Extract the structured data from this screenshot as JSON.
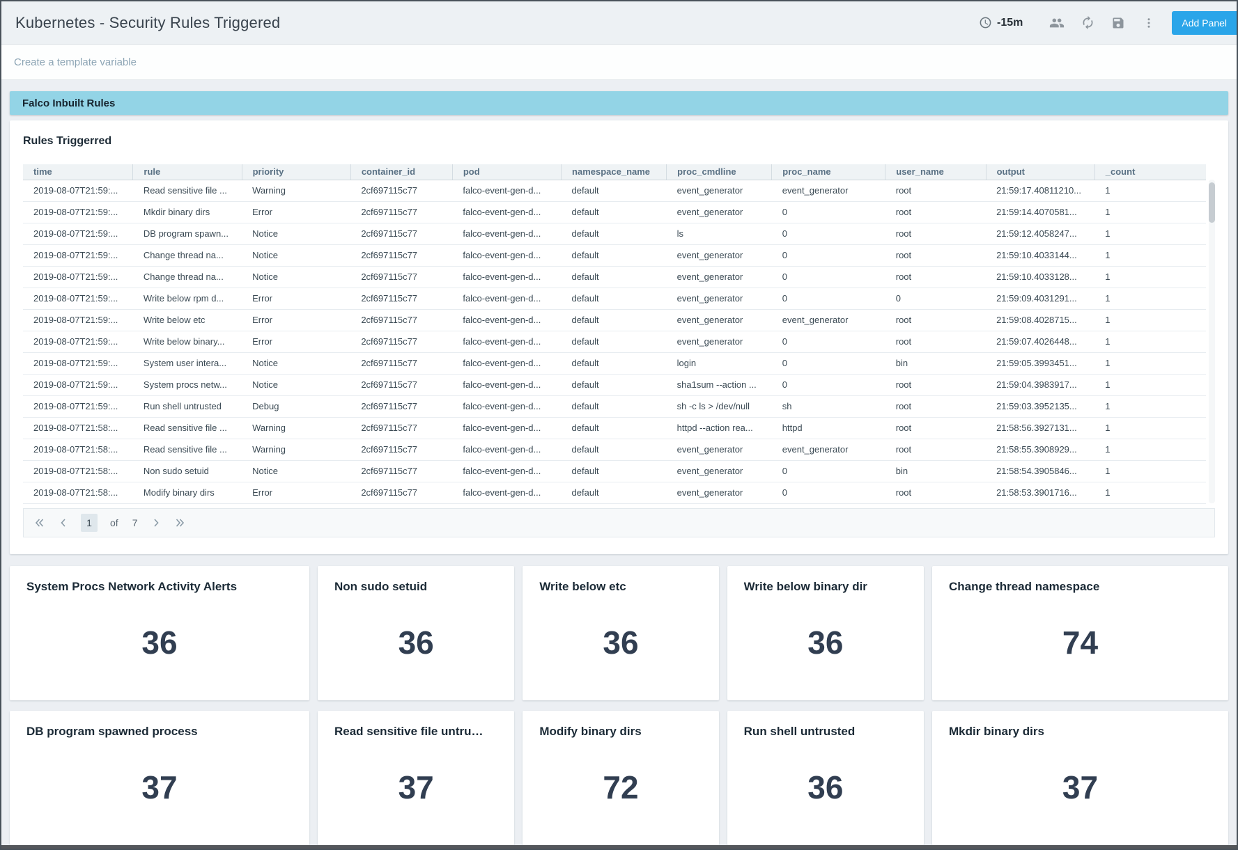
{
  "header": {
    "title": "Kubernetes - Security Rules Triggered",
    "time_range": "-15m",
    "add_panel_label": "Add Panel",
    "icons": [
      "clock-icon",
      "people-icon",
      "refresh-icon",
      "save-icon",
      "kebab-menu-icon"
    ]
  },
  "template_bar": {
    "link_label": "Create a template variable"
  },
  "section_banner": {
    "label": "Falco Inbuilt Rules"
  },
  "rules_panel": {
    "title": "Rules Triggerred",
    "columns": [
      "time",
      "rule",
      "priority",
      "container_id",
      "pod",
      "namespace_name",
      "proc_cmdline",
      "proc_name",
      "user_name",
      "output",
      "_count"
    ],
    "rows": [
      [
        "2019-08-07T21:59:...",
        "Read sensitive file ...",
        "Warning",
        "2cf697115c77",
        "falco-event-gen-d...",
        "default",
        "event_generator",
        "event_generator",
        "root",
        "21:59:17.40811210...",
        "1"
      ],
      [
        "2019-08-07T21:59:...",
        "Mkdir binary dirs",
        "Error",
        "2cf697115c77",
        "falco-event-gen-d...",
        "default",
        "event_generator",
        "0",
        "root",
        "21:59:14.4070581...",
        "1"
      ],
      [
        "2019-08-07T21:59:...",
        "DB program spawn...",
        "Notice",
        "2cf697115c77",
        "falco-event-gen-d...",
        "default",
        "ls",
        "0",
        "root",
        "21:59:12.4058247...",
        "1"
      ],
      [
        "2019-08-07T21:59:...",
        "Change thread na...",
        "Notice",
        "2cf697115c77",
        "falco-event-gen-d...",
        "default",
        "event_generator",
        "0",
        "root",
        "21:59:10.4033144...",
        "1"
      ],
      [
        "2019-08-07T21:59:...",
        "Change thread na...",
        "Notice",
        "2cf697115c77",
        "falco-event-gen-d...",
        "default",
        "event_generator",
        "0",
        "root",
        "21:59:10.4033128...",
        "1"
      ],
      [
        "2019-08-07T21:59:...",
        "Write below rpm d...",
        "Error",
        "2cf697115c77",
        "falco-event-gen-d...",
        "default",
        "event_generator",
        "0",
        "0",
        "21:59:09.4031291...",
        "1"
      ],
      [
        "2019-08-07T21:59:...",
        "Write below etc",
        "Error",
        "2cf697115c77",
        "falco-event-gen-d...",
        "default",
        "event_generator",
        "event_generator",
        "root",
        "21:59:08.4028715...",
        "1"
      ],
      [
        "2019-08-07T21:59:...",
        "Write below binary...",
        "Error",
        "2cf697115c77",
        "falco-event-gen-d...",
        "default",
        "event_generator",
        "0",
        "root",
        "21:59:07.4026448...",
        "1"
      ],
      [
        "2019-08-07T21:59:...",
        "System user intera...",
        "Notice",
        "2cf697115c77",
        "falco-event-gen-d...",
        "default",
        "login",
        "0",
        "bin",
        "21:59:05.3993451...",
        "1"
      ],
      [
        "2019-08-07T21:59:...",
        "System procs netw...",
        "Notice",
        "2cf697115c77",
        "falco-event-gen-d...",
        "default",
        "sha1sum --action ...",
        "0",
        "root",
        "21:59:04.3983917...",
        "1"
      ],
      [
        "2019-08-07T21:59:...",
        "Run shell untrusted",
        "Debug",
        "2cf697115c77",
        "falco-event-gen-d...",
        "default",
        "sh -c ls > /dev/null",
        "sh",
        "root",
        "21:59:03.3952135...",
        "1"
      ],
      [
        "2019-08-07T21:58:...",
        "Read sensitive file ...",
        "Warning",
        "2cf697115c77",
        "falco-event-gen-d...",
        "default",
        "httpd --action rea...",
        "httpd",
        "root",
        "21:58:56.3927131...",
        "1"
      ],
      [
        "2019-08-07T21:58:...",
        "Read sensitive file ...",
        "Warning",
        "2cf697115c77",
        "falco-event-gen-d...",
        "default",
        "event_generator",
        "event_generator",
        "root",
        "21:58:55.3908929...",
        "1"
      ],
      [
        "2019-08-07T21:58:...",
        "Non sudo setuid",
        "Notice",
        "2cf697115c77",
        "falco-event-gen-d...",
        "default",
        "event_generator",
        "0",
        "bin",
        "21:58:54.3905846...",
        "1"
      ],
      [
        "2019-08-07T21:58:...",
        "Modify binary dirs",
        "Error",
        "2cf697115c77",
        "falco-event-gen-d...",
        "default",
        "event_generator",
        "0",
        "root",
        "21:58:53.3901716...",
        "1"
      ]
    ],
    "pagination": {
      "current_page": "1",
      "of_label": "of",
      "total_pages": "7"
    }
  },
  "stat_panels": {
    "row1": [
      {
        "title": "System Procs Network Activity Alerts",
        "value": "36"
      },
      {
        "title": "Non sudo setuid",
        "value": "36"
      },
      {
        "title": "Write below etc",
        "value": "36"
      },
      {
        "title": "Write below binary dir",
        "value": "36"
      },
      {
        "title": "Change thread namespace",
        "value": "74"
      }
    ],
    "row2": [
      {
        "title": "DB program spawned process",
        "value": "37"
      },
      {
        "title": "Read sensitive file untru…",
        "value": "37"
      },
      {
        "title": "Modify binary dirs",
        "value": "72"
      },
      {
        "title": "Run shell untrusted",
        "value": "36"
      },
      {
        "title": "Mkdir binary dirs",
        "value": "37"
      }
    ]
  },
  "colors": {
    "accent_blue": "#2aa5e9",
    "banner_blue": "#93d4e6",
    "dark_text": "#1d2b36",
    "stat_value": "#313e51",
    "table_header_text": "#5a7184",
    "table_text": "#3b4a54",
    "muted_icon": "#8d959c",
    "link": "#8da5b5"
  }
}
